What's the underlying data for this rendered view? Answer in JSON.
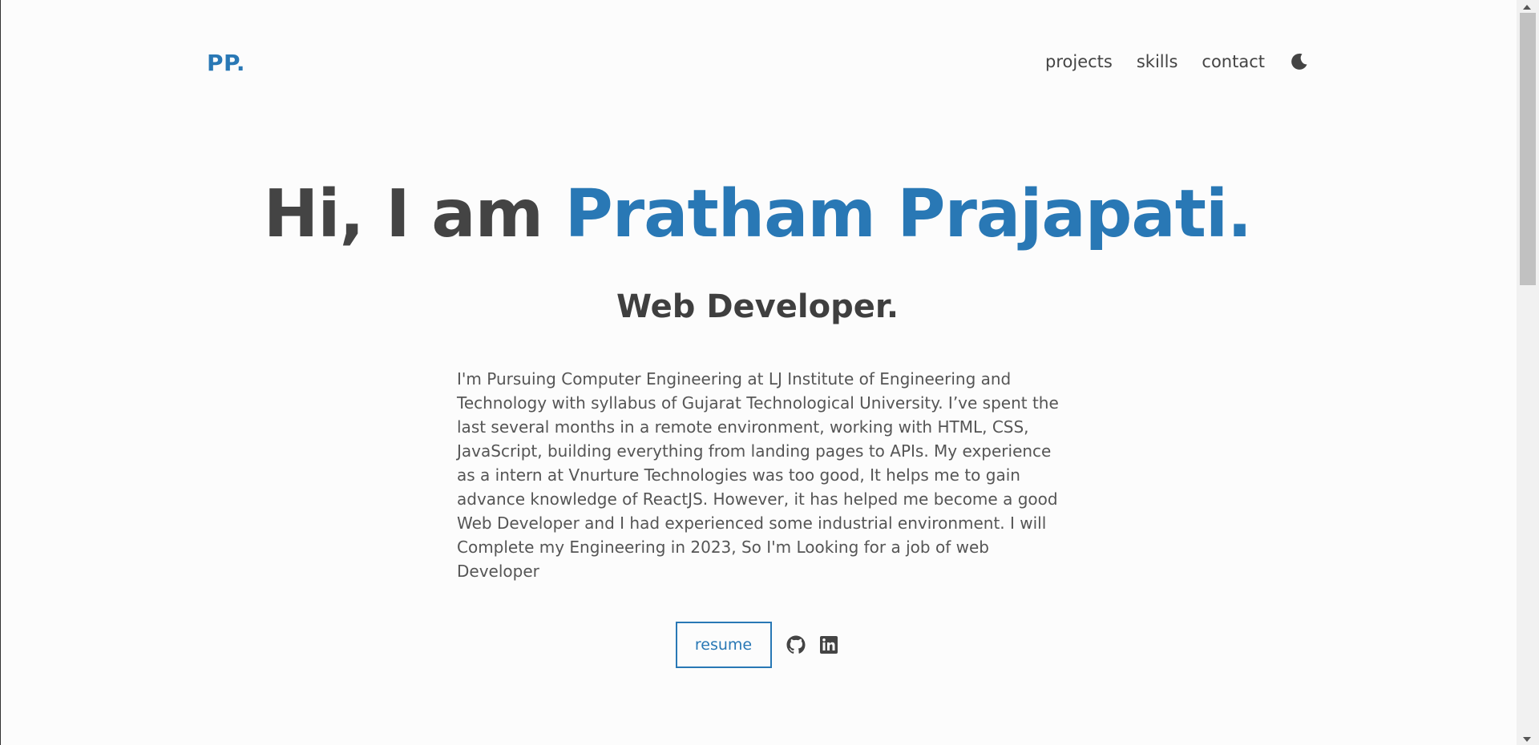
{
  "colors": {
    "accent": "#2978b5",
    "text": "#444444",
    "background": "#fcfcfc"
  },
  "header": {
    "logo": "PP.",
    "nav": [
      {
        "label": "projects"
      },
      {
        "label": "skills"
      },
      {
        "label": "contact"
      }
    ],
    "theme_toggle_icon": "moon-icon"
  },
  "hero": {
    "greeting": "Hi, I am ",
    "name": "Pratham Prajapati.",
    "role": "Web Developer.",
    "about": "I'm Pursuing Computer Engineering at LJ Institute of Engineering and Technology with syllabus of Gujarat Technological University. I’ve spent the last several months in a remote environment, working with HTML, CSS, JavaScript, building everything from landing pages to APIs. My experience as a intern at Vnurture Technologies was too good, It helps me to gain advance knowledge of ReactJS. However, it has helped me become a good Web Developer and I had experienced some industrial environment. I will Complete my Engineering in 2023, So I'm Looking for a job of web Developer"
  },
  "actions": {
    "resume_label": "resume",
    "social_icons": [
      "github-icon",
      "linkedin-icon"
    ]
  }
}
